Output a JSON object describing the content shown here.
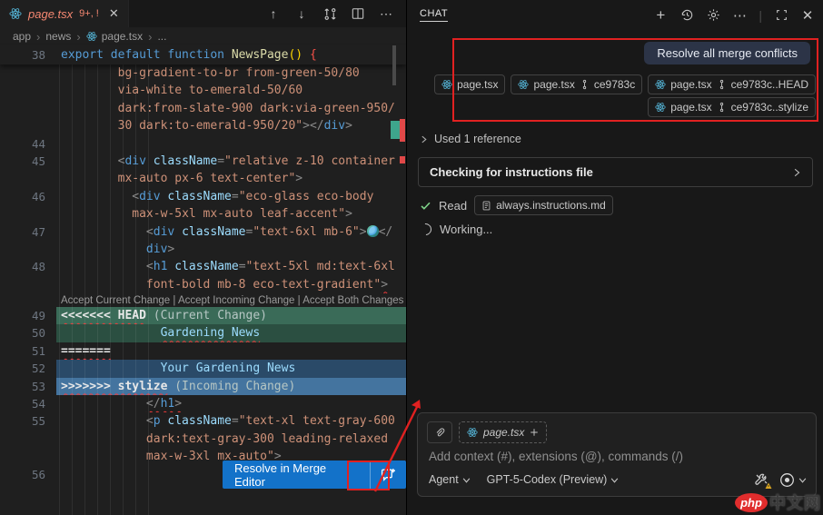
{
  "icons": {
    "chevron": "›",
    "close": "✕",
    "more": "⋯",
    "up": "↑",
    "down": "↓",
    "plus": "+",
    "pipe": "|",
    "chevR": "›"
  },
  "editor": {
    "tab": {
      "title": "page.tsx",
      "badge": "9+, !"
    },
    "breadcrumb": [
      "app",
      "news",
      "page.tsx",
      "..."
    ],
    "sticky": {
      "num": "38",
      "seg": [
        [
          "k",
          "export default function"
        ],
        [
          "d",
          " "
        ],
        [
          "f",
          "NewsPage"
        ],
        [
          "pa",
          "()"
        ],
        [
          "d",
          " "
        ],
        [
          "br",
          "{"
        ]
      ]
    },
    "codelens": {
      "links": [
        "Accept Current Change",
        "Accept Incoming Change",
        "Accept Both Changes"
      ],
      "separator": " | "
    },
    "rows": [
      {
        "ind": 8,
        "seg": [
          [
            "s",
            "bg-gradient-to-br from-green-50/80"
          ]
        ]
      },
      {
        "ind": 8,
        "seg": [
          [
            "s",
            "via-white to-emerald-50/60"
          ]
        ]
      },
      {
        "ind": 8,
        "seg": [
          [
            "s",
            "dark:from-slate-900 dark:via-green-950/"
          ]
        ]
      },
      {
        "ind": 8,
        "seg": [
          [
            "s",
            "30 dark:to-emerald-950/20\""
          ],
          [
            "p",
            "></"
          ],
          [
            "t",
            "div"
          ],
          [
            "p",
            ">"
          ]
        ]
      },
      {
        "num": "44"
      },
      {
        "num": "45",
        "ind": 8,
        "seg": [
          [
            "p",
            "<"
          ],
          [
            "t",
            "div"
          ],
          [
            "d",
            " "
          ],
          [
            "a",
            "className"
          ],
          [
            "p",
            "="
          ],
          [
            "s",
            "\"relative z-10 container"
          ]
        ]
      },
      {
        "ind": 8,
        "seg": [
          [
            "s",
            "mx-auto px-6 text-center\""
          ],
          [
            "p",
            ">"
          ]
        ]
      },
      {
        "num": "46",
        "ind": 10,
        "seg": [
          [
            "p",
            "<"
          ],
          [
            "t",
            "div"
          ],
          [
            "d",
            " "
          ],
          [
            "a",
            "className"
          ],
          [
            "p",
            "="
          ],
          [
            "s",
            "\"eco-glass eco-body"
          ]
        ]
      },
      {
        "ind": 10,
        "seg": [
          [
            "s",
            "max-w-5xl mx-auto leaf-accent\""
          ],
          [
            "p",
            ">"
          ]
        ]
      },
      {
        "num": "47",
        "ind": 12,
        "seg": [
          [
            "p",
            "<"
          ],
          [
            "t",
            "div"
          ],
          [
            "d",
            " "
          ],
          [
            "a",
            "className"
          ],
          [
            "p",
            "="
          ],
          [
            "s",
            "\"text-6xl mb-6\""
          ],
          [
            "p",
            ">"
          ],
          [
            "e",
            ""
          ],
          [
            "p",
            "</"
          ]
        ]
      },
      {
        "ind": 12,
        "seg": [
          [
            "t",
            "div"
          ],
          [
            "p",
            ">"
          ]
        ]
      },
      {
        "num": "48",
        "ind": 12,
        "seg": [
          [
            "p",
            "<"
          ],
          [
            "t",
            "h1"
          ],
          [
            "d",
            " "
          ],
          [
            "a",
            "className"
          ],
          [
            "p",
            "="
          ],
          [
            "s",
            "\"text-5xl md:text-6xl"
          ]
        ]
      },
      {
        "ind": 12,
        "seg": [
          [
            "s",
            "font-bold mb-8 eco-text-gradient\""
          ],
          [
            "p",
            ">",
            1
          ]
        ]
      },
      {
        "lens": true
      },
      {
        "num": "49",
        "bg": "ch",
        "seg": [
          [
            "m",
            "<<<<<<< HEAD",
            1
          ],
          [
            "n",
            " (Current Change)"
          ]
        ]
      },
      {
        "num": "50",
        "bg": "cc",
        "ind": 14,
        "seg": [
          [
            "x",
            "Gardening News",
            1
          ]
        ]
      },
      {
        "num": "51",
        "seg": [
          [
            "m",
            "=======",
            1
          ]
        ]
      },
      {
        "num": "52",
        "bg": "ic",
        "ind": 14,
        "seg": [
          [
            "x",
            "Your Gardening News"
          ]
        ]
      },
      {
        "num": "53",
        "bg": "ih",
        "seg": [
          [
            "m",
            ">>>>>>> stylize",
            1
          ],
          [
            "n",
            " (Incoming Change)"
          ]
        ]
      },
      {
        "num": "54",
        "ind": 12,
        "seg": [
          [
            "p",
            "</",
            1
          ],
          [
            "t",
            "h1",
            1
          ],
          [
            "p",
            ">",
            1
          ]
        ]
      },
      {
        "num": "55",
        "ind": 12,
        "seg": [
          [
            "p",
            "<"
          ],
          [
            "t",
            "p"
          ],
          [
            "d",
            " "
          ],
          [
            "a",
            "className"
          ],
          [
            "p",
            "="
          ],
          [
            "s",
            "\"text-xl text-gray-600"
          ]
        ]
      },
      {
        "ind": 12,
        "seg": [
          [
            "s",
            "dark:text-gray-300 leading-relaxed"
          ]
        ]
      },
      {
        "ind": 12,
        "seg": [
          [
            "s",
            "max-w-3xl mx-auto\""
          ],
          [
            "p",
            ">"
          ]
        ]
      },
      {
        "num": "56"
      },
      {},
      {}
    ],
    "merge_button": {
      "label": "Resolve in Merge Editor"
    }
  },
  "chat": {
    "header": {
      "title": "CHAT"
    },
    "request": {
      "text": "Resolve all merge conflicts"
    },
    "chips_row1": [
      {
        "file": "page.tsx"
      },
      {
        "file": "page.tsx",
        "ref": "ce9783c"
      },
      {
        "file": "page.tsx",
        "ref": "ce9783c..HEAD"
      }
    ],
    "chips_row2": [
      {
        "file": "page.tsx",
        "ref": "ce9783c..stylize"
      }
    ],
    "used_reference": "Used 1 reference",
    "tool_card": "Checking for instructions file",
    "read": {
      "label": "Read",
      "file": "always.instructions.md"
    },
    "working": "Working...",
    "input": {
      "context_file": "page.tsx",
      "placeholder": "Add context (#), extensions (@), commands (/)",
      "mode": "Agent",
      "model": "GPT-5-Codex (Preview)"
    }
  },
  "watermark": {
    "badge": "php",
    "text": "中文网"
  },
  "colors": {
    "button_blue": "#1372c9",
    "annotation_red": "#e12121",
    "merge_current": "#3a6b58",
    "merge_incoming": "#44749f",
    "error_red": "#f48771"
  }
}
